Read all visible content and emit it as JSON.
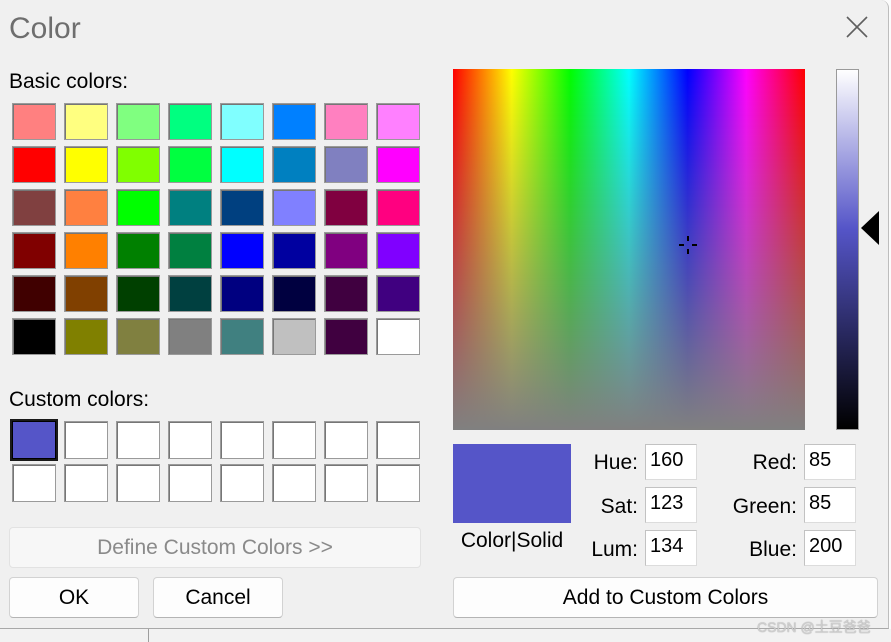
{
  "window": {
    "title": "Color",
    "background": "#F0F0F0"
  },
  "icons": {
    "close": "close-icon",
    "crosshair": "crosshair-icon",
    "lum_pointer": "triangle-left-icon"
  },
  "basic_colors": {
    "label": "Basic colors:",
    "rows": [
      [
        "#FF8080",
        "#FFFF80",
        "#80FF80",
        "#00FF80",
        "#80FFFF",
        "#0080FF",
        "#FF80C0",
        "#FF80FF"
      ],
      [
        "#FF0000",
        "#FFFF00",
        "#80FF00",
        "#00FF40",
        "#00FFFF",
        "#0080C0",
        "#8080C0",
        "#FF00FF"
      ],
      [
        "#804040",
        "#FF8040",
        "#00FF00",
        "#008080",
        "#004080",
        "#8080FF",
        "#800040",
        "#FF0080"
      ],
      [
        "#800000",
        "#FF8000",
        "#008000",
        "#008040",
        "#0000FF",
        "#0000A0",
        "#800080",
        "#8000FF"
      ],
      [
        "#400000",
        "#804000",
        "#004000",
        "#004040",
        "#000080",
        "#000040",
        "#400040",
        "#400080"
      ],
      [
        "#000000",
        "#808000",
        "#808040",
        "#808080",
        "#408080",
        "#C0C0C0",
        "#400040",
        "#FFFFFF"
      ]
    ]
  },
  "custom_colors": {
    "label": "Custom colors:",
    "selected_index": 0,
    "rows": [
      [
        "#5555C8",
        "#FFFFFF",
        "#FFFFFF",
        "#FFFFFF",
        "#FFFFFF",
        "#FFFFFF",
        "#FFFFFF",
        "#FFFFFF"
      ],
      [
        "#FFFFFF",
        "#FFFFFF",
        "#FFFFFF",
        "#FFFFFF",
        "#FFFFFF",
        "#FFFFFF",
        "#FFFFFF",
        "#FFFFFF"
      ]
    ]
  },
  "buttons": {
    "define_custom": {
      "label": "Define Custom Colors >>",
      "enabled": false
    },
    "ok": "OK",
    "cancel": "Cancel",
    "add_custom": "Add to Custom Colors"
  },
  "preview": {
    "label": "Color|Solid",
    "color": "#5555C8"
  },
  "color_fields": {
    "hue": {
      "label": "Hue:",
      "value": "160"
    },
    "sat": {
      "label": "Sat:",
      "value": "123"
    },
    "lum": {
      "label": "Lum:",
      "value": "134"
    },
    "red": {
      "label": "Red:",
      "value": "85"
    },
    "green": {
      "label": "Green:",
      "value": "85"
    },
    "blue": {
      "label": "Blue:",
      "value": "200"
    }
  },
  "watermark": "CSDN @土豆爸爸"
}
